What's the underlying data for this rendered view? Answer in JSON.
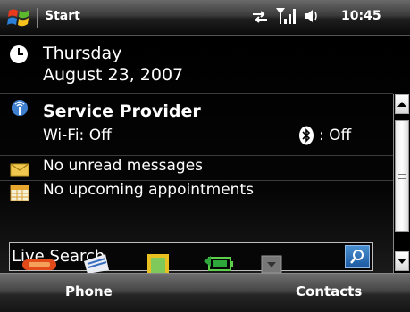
{
  "title_bar": {
    "title": "Start",
    "clock": "10:45"
  },
  "date": {
    "weekday": "Thursday",
    "full_date": "August 23, 2007"
  },
  "connectivity": {
    "provider": "Service Provider",
    "wifi": "Wi-Fi: Off",
    "bluetooth": ": Off"
  },
  "messages": {
    "label": "No unread messages"
  },
  "calendar": {
    "label": "No upcoming appointments"
  },
  "search": {
    "label": "Live Search"
  },
  "softkeys": {
    "left": "Phone",
    "right": "Contacts"
  },
  "icons": {
    "start": "windows-flag-icon",
    "sync": "sync-arrows-icon",
    "signal": "signal-strength-icon",
    "volume": "speaker-icon",
    "clock": "clock-icon",
    "wireless": "wireless-antenna-icon",
    "bluetooth": "bluetooth-icon",
    "envelope": "envelope-icon",
    "calendar": "calendar-icon",
    "search": "magnifier-icon"
  },
  "colors": {
    "background": "#000000",
    "accent_blue": "#1b58a0",
    "divider": "#3b3b3b",
    "softkey_bar": "#2a2a2a"
  }
}
